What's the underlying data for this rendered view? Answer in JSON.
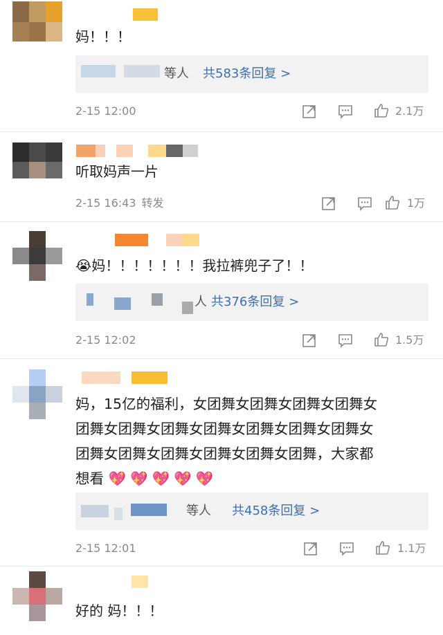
{
  "comments": [
    {
      "text": "妈！！！",
      "reply": {
        "who": "等人",
        "total": "共583条回复 >"
      },
      "time": "2-15 12:00",
      "forward": "",
      "likes": "2.1万"
    },
    {
      "text": "听取妈声一片",
      "reply": null,
      "time": "2-15 16:43",
      "forward": "转发",
      "likes": "1万"
    },
    {
      "text": "妈！！！！！！！我拉裤兜子了！！",
      "emoji": "😭",
      "reply": {
        "who": "人",
        "total": "共376条回复 >"
      },
      "time": "2-15 12:02",
      "forward": "",
      "likes": "1.5万"
    },
    {
      "text_lines": [
        "妈，15亿的福利，女团舞女团舞女团舞女团舞女",
        "团舞女团舞女团舞女团舞女团舞女团舞女团舞女",
        "团舞女团舞女团舞女团舞女团舞女团舞，大家都",
        "想看"
      ],
      "emojis": "💖💖💖💖💖",
      "reply": {
        "who": "等人",
        "total": "共458条回复 >"
      },
      "time": "2-15 12:01",
      "forward": "",
      "likes": "1.1万"
    },
    {
      "text": "好的 妈！！！",
      "reply": null
    }
  ],
  "icons": [
    "share-icon",
    "comment-icon",
    "like-icon"
  ],
  "colors": {
    "link": "#3a6fb5",
    "meta": "#8a8a8a",
    "reply_bg": "#f2f2f2"
  }
}
